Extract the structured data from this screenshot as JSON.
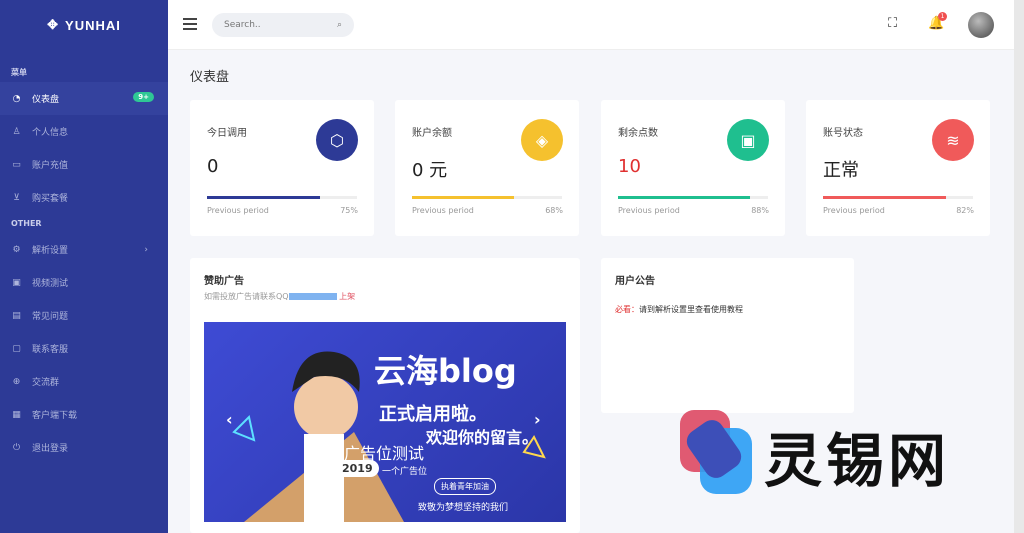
{
  "brand": {
    "name": "YUNHAI"
  },
  "sidebar": {
    "section1": "菜单",
    "section2": "OTHER",
    "menu": [
      {
        "label": "仪表盘",
        "icon": "dashboard-icon",
        "badge": "9+",
        "active": true
      },
      {
        "label": "个人信息",
        "icon": "user-icon"
      },
      {
        "label": "账户充值",
        "icon": "credit-card-icon"
      },
      {
        "label": "购买套餐",
        "icon": "cart-icon"
      }
    ],
    "other": [
      {
        "label": "解析设置",
        "icon": "settings-icon",
        "has_arrow": true
      },
      {
        "label": "视频测试",
        "icon": "video-icon"
      },
      {
        "label": "常见问题",
        "icon": "help-icon"
      },
      {
        "label": "联系客服",
        "icon": "chat-icon"
      },
      {
        "label": "交流群",
        "icon": "group-icon"
      },
      {
        "label": "客户端下载",
        "icon": "download-icon"
      },
      {
        "label": "退出登录",
        "icon": "power-icon"
      }
    ]
  },
  "topbar": {
    "search_placeholder": "Search..",
    "notification_count": "1"
  },
  "page": {
    "title": "仪表盘"
  },
  "stats": [
    {
      "label": "今日调用",
      "value": "0",
      "color": "#2d3a96",
      "progress": 75,
      "prev": "Previous period",
      "pct": "75%",
      "icon": "cube-icon"
    },
    {
      "label": "账户余额",
      "value": "0 元",
      "color": "#f5c12e",
      "progress": 68,
      "prev": "Previous period",
      "pct": "68%",
      "icon": "tag-icon"
    },
    {
      "label": "剩余点数",
      "value": "10",
      "color": "#1fbf8f",
      "progress": 88,
      "prev": "Previous period",
      "pct": "88%",
      "icon": "briefcase-icon",
      "value_color": "#e03030"
    },
    {
      "label": "账号状态",
      "value": "正常",
      "color": "#f05a5a",
      "progress": 82,
      "prev": "Previous period",
      "pct": "82%",
      "icon": "layers-icon"
    }
  ],
  "ad": {
    "title": "赞助广告",
    "subtitle": "如需投放广告请联系QQ",
    "link": "上架",
    "banner": {
      "headline": "云海blog",
      "line2": "正式启用啦。",
      "line3": "欢迎你的留言。",
      "caption1": "广告位测试",
      "year": "2019",
      "caption2": "一个广告位",
      "tag": "执着青年加油",
      "slogan": "致敬为梦想坚持的我们"
    }
  },
  "notice": {
    "title": "用户公告",
    "label": "必看：",
    "text": "请到解析设置里查看使用教程"
  },
  "watermark": {
    "text": "灵锡网"
  }
}
